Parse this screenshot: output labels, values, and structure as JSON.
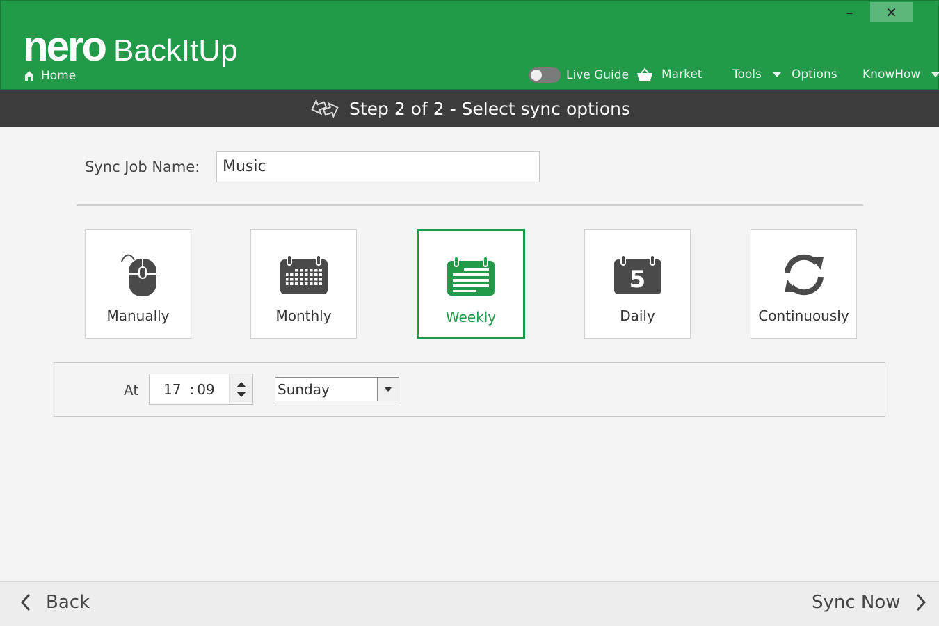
{
  "app": {
    "brand": "nero",
    "product": "BackItUp",
    "home": "Home"
  },
  "nav": {
    "live_guide": "Live Guide",
    "live_guide_on": false,
    "market": "Market",
    "tools": "Tools",
    "options": "Options",
    "knowhow": "KnowHow"
  },
  "window": {
    "minimize": "–",
    "close": "✕"
  },
  "step": {
    "title": "Step 2 of 2 - Select sync options"
  },
  "job": {
    "label": "Sync Job Name:",
    "value": "Music"
  },
  "schedule": {
    "options": [
      {
        "label": "Manually",
        "icon": "mouse-icon",
        "selected": false
      },
      {
        "label": "Monthly",
        "icon": "calendar-month-icon",
        "selected": false
      },
      {
        "label": "Weekly",
        "icon": "calendar-week-icon",
        "selected": true
      },
      {
        "label": "Daily",
        "icon": "calendar-day-icon",
        "selected": false
      },
      {
        "label": "Continuously",
        "icon": "refresh-icon",
        "selected": false
      }
    ],
    "daily_number": "5"
  },
  "time": {
    "at_label": "At",
    "hour": "17",
    "separator": ":",
    "minute": "09",
    "day": "Sunday"
  },
  "footer": {
    "back": "Back",
    "sync_now": "Sync Now"
  },
  "colors": {
    "accent": "#229a4a",
    "step_bar": "#3c3c3c",
    "icon": "#4a4a4a"
  }
}
